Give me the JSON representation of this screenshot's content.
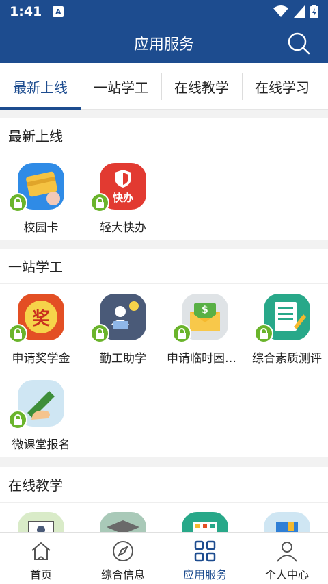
{
  "status": {
    "time": "1:41",
    "badge": "A"
  },
  "header": {
    "title": "应用服务"
  },
  "tabs": [
    {
      "label": "最新上线"
    },
    {
      "label": "一站学工"
    },
    {
      "label": "在线教学"
    },
    {
      "label": "在线学习"
    }
  ],
  "sections": [
    {
      "title": "最新上线",
      "apps": [
        {
          "label": "校园卡",
          "icon": "campus-card-icon"
        },
        {
          "label": "轻大快办",
          "icon": "quick-office-icon",
          "icon_text": "快办"
        }
      ]
    },
    {
      "title": "一站学工",
      "apps": [
        {
          "label": "申请奖学金",
          "icon": "scholarship-icon",
          "icon_text": "奖"
        },
        {
          "label": "勤工助学",
          "icon": "work-study-icon"
        },
        {
          "label": "申请临时困难补助",
          "icon": "temporary-aid-icon",
          "icon_text": "$"
        },
        {
          "label": "综合素质测评",
          "icon": "quality-assessment-icon"
        },
        {
          "label": "微课堂报名",
          "icon": "micro-class-icon"
        }
      ]
    },
    {
      "title": "在线教学",
      "apps": []
    }
  ],
  "nav": [
    {
      "label": "首页",
      "icon": "home-icon"
    },
    {
      "label": "综合信息",
      "icon": "compass-icon"
    },
    {
      "label": "应用服务",
      "icon": "apps-grid-icon"
    },
    {
      "label": "个人中心",
      "icon": "person-icon"
    }
  ],
  "colors": {
    "primary": "#1d4c8f",
    "lock": "#6ab42b",
    "background": "#f2f2f2"
  }
}
